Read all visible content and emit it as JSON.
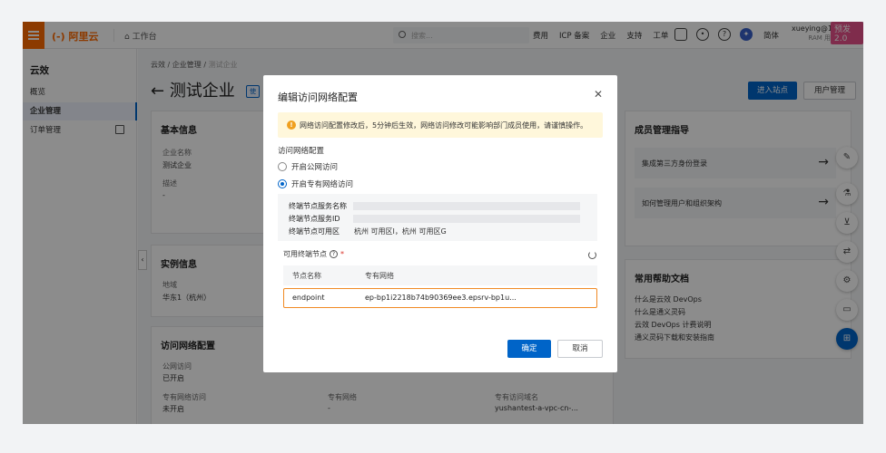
{
  "header": {
    "logo": "(-) 阿里云",
    "workbench": "工作台",
    "search_placeholder": "搜索...",
    "nav": [
      "费用",
      "ICP 备案",
      "企业",
      "支持",
      "工单"
    ],
    "lang": "简体",
    "user_name": "xueying@13",
    "user_sub": "RAM 用户",
    "badge": "预发2.0"
  },
  "sidebar": {
    "title": "云效",
    "items": [
      {
        "label": "概览"
      },
      {
        "label": "企业管理"
      },
      {
        "label": "订单管理"
      }
    ]
  },
  "main": {
    "breadcrumb": [
      "云效",
      "企业管理",
      "测试企业"
    ],
    "title": "测试企业",
    "title_tag": "使",
    "enter_site": "进入站点",
    "user_manage": "用户管理",
    "basic": {
      "title": "基本信息",
      "name_label": "企业名称",
      "name_value": "测试企业",
      "desc_label": "描述",
      "desc_value": "-"
    },
    "instance": {
      "title": "实例信息",
      "region_label": "地域",
      "region_value": "华东1（杭州）"
    },
    "access": {
      "title": "访问网络配置",
      "public_label": "公网访问",
      "public_value": "已开启",
      "private_label": "专有网络访问",
      "private_value": "未开启",
      "vpc_label": "专有网络",
      "vpc_value": "-",
      "domain_label": "专有访问域名",
      "domain_value": "yushantest-a-vpc-cn-..."
    },
    "guide": {
      "title": "成员管理指导",
      "rows": [
        "集成第三方身份登录",
        "如何管理用户和组织架构"
      ]
    },
    "help": {
      "title": "常用帮助文档",
      "links": [
        "什么是云效 DevOps",
        "什么是通义灵码",
        "云效 DevOps 计费说明",
        "通义灵码下载和安装指南"
      ]
    }
  },
  "modal": {
    "title": "编辑访问网络配置",
    "warning": "网络访问配置修改后，5分钟后生效，网络访问修改可能影响部门成员使用，请谨慎操作。",
    "section": "访问网络配置",
    "radio_public": "开启公网访问",
    "radio_private": "开启专有网络访问",
    "info": {
      "service_name_label": "终端节点服务名称",
      "service_id_label": "终端节点服务ID",
      "zone_label": "终端节点可用区",
      "zone_value": "杭州 可用区I，杭州 可用区G"
    },
    "endpoints_label": "可用终端节点",
    "required_mark": "*",
    "table": {
      "col_name": "节点名称",
      "col_vpc": "专有网络",
      "rows": [
        {
          "name": "endpoint",
          "vpc": "ep-bp1i2218b74b90369ee3.epsrv-bp1u..."
        }
      ]
    },
    "confirm": "确定",
    "cancel": "取消"
  },
  "colors": {
    "brand": "#ff6a00",
    "primary": "#0064c8",
    "highlight": "#f08a24",
    "warning_bg": "#fff7db"
  }
}
